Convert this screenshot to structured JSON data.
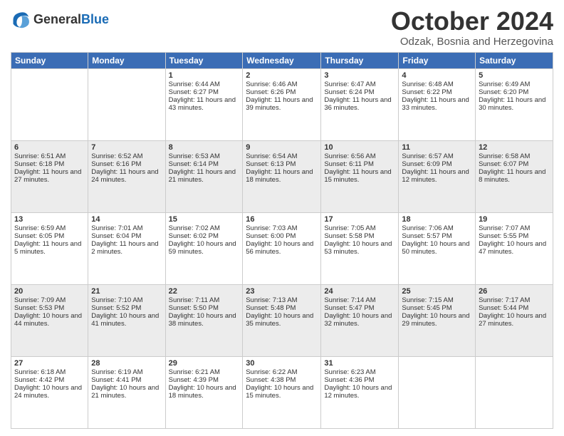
{
  "header": {
    "logo_line1": "General",
    "logo_line2": "Blue",
    "month": "October 2024",
    "location": "Odzak, Bosnia and Herzegovina"
  },
  "days_of_week": [
    "Sunday",
    "Monday",
    "Tuesday",
    "Wednesday",
    "Thursday",
    "Friday",
    "Saturday"
  ],
  "weeks": [
    {
      "bg": "white",
      "days": [
        {
          "num": "",
          "sunrise": "",
          "sunset": "",
          "daylight": ""
        },
        {
          "num": "",
          "sunrise": "",
          "sunset": "",
          "daylight": ""
        },
        {
          "num": "1",
          "sunrise": "Sunrise: 6:44 AM",
          "sunset": "Sunset: 6:27 PM",
          "daylight": "Daylight: 11 hours and 43 minutes."
        },
        {
          "num": "2",
          "sunrise": "Sunrise: 6:46 AM",
          "sunset": "Sunset: 6:26 PM",
          "daylight": "Daylight: 11 hours and 39 minutes."
        },
        {
          "num": "3",
          "sunrise": "Sunrise: 6:47 AM",
          "sunset": "Sunset: 6:24 PM",
          "daylight": "Daylight: 11 hours and 36 minutes."
        },
        {
          "num": "4",
          "sunrise": "Sunrise: 6:48 AM",
          "sunset": "Sunset: 6:22 PM",
          "daylight": "Daylight: 11 hours and 33 minutes."
        },
        {
          "num": "5",
          "sunrise": "Sunrise: 6:49 AM",
          "sunset": "Sunset: 6:20 PM",
          "daylight": "Daylight: 11 hours and 30 minutes."
        }
      ]
    },
    {
      "bg": "gray",
      "days": [
        {
          "num": "6",
          "sunrise": "Sunrise: 6:51 AM",
          "sunset": "Sunset: 6:18 PM",
          "daylight": "Daylight: 11 hours and 27 minutes."
        },
        {
          "num": "7",
          "sunrise": "Sunrise: 6:52 AM",
          "sunset": "Sunset: 6:16 PM",
          "daylight": "Daylight: 11 hours and 24 minutes."
        },
        {
          "num": "8",
          "sunrise": "Sunrise: 6:53 AM",
          "sunset": "Sunset: 6:14 PM",
          "daylight": "Daylight: 11 hours and 21 minutes."
        },
        {
          "num": "9",
          "sunrise": "Sunrise: 6:54 AM",
          "sunset": "Sunset: 6:13 PM",
          "daylight": "Daylight: 11 hours and 18 minutes."
        },
        {
          "num": "10",
          "sunrise": "Sunrise: 6:56 AM",
          "sunset": "Sunset: 6:11 PM",
          "daylight": "Daylight: 11 hours and 15 minutes."
        },
        {
          "num": "11",
          "sunrise": "Sunrise: 6:57 AM",
          "sunset": "Sunset: 6:09 PM",
          "daylight": "Daylight: 11 hours and 12 minutes."
        },
        {
          "num": "12",
          "sunrise": "Sunrise: 6:58 AM",
          "sunset": "Sunset: 6:07 PM",
          "daylight": "Daylight: 11 hours and 8 minutes."
        }
      ]
    },
    {
      "bg": "white",
      "days": [
        {
          "num": "13",
          "sunrise": "Sunrise: 6:59 AM",
          "sunset": "Sunset: 6:05 PM",
          "daylight": "Daylight: 11 hours and 5 minutes."
        },
        {
          "num": "14",
          "sunrise": "Sunrise: 7:01 AM",
          "sunset": "Sunset: 6:04 PM",
          "daylight": "Daylight: 11 hours and 2 minutes."
        },
        {
          "num": "15",
          "sunrise": "Sunrise: 7:02 AM",
          "sunset": "Sunset: 6:02 PM",
          "daylight": "Daylight: 10 hours and 59 minutes."
        },
        {
          "num": "16",
          "sunrise": "Sunrise: 7:03 AM",
          "sunset": "Sunset: 6:00 PM",
          "daylight": "Daylight: 10 hours and 56 minutes."
        },
        {
          "num": "17",
          "sunrise": "Sunrise: 7:05 AM",
          "sunset": "Sunset: 5:58 PM",
          "daylight": "Daylight: 10 hours and 53 minutes."
        },
        {
          "num": "18",
          "sunrise": "Sunrise: 7:06 AM",
          "sunset": "Sunset: 5:57 PM",
          "daylight": "Daylight: 10 hours and 50 minutes."
        },
        {
          "num": "19",
          "sunrise": "Sunrise: 7:07 AM",
          "sunset": "Sunset: 5:55 PM",
          "daylight": "Daylight: 10 hours and 47 minutes."
        }
      ]
    },
    {
      "bg": "gray",
      "days": [
        {
          "num": "20",
          "sunrise": "Sunrise: 7:09 AM",
          "sunset": "Sunset: 5:53 PM",
          "daylight": "Daylight: 10 hours and 44 minutes."
        },
        {
          "num": "21",
          "sunrise": "Sunrise: 7:10 AM",
          "sunset": "Sunset: 5:52 PM",
          "daylight": "Daylight: 10 hours and 41 minutes."
        },
        {
          "num": "22",
          "sunrise": "Sunrise: 7:11 AM",
          "sunset": "Sunset: 5:50 PM",
          "daylight": "Daylight: 10 hours and 38 minutes."
        },
        {
          "num": "23",
          "sunrise": "Sunrise: 7:13 AM",
          "sunset": "Sunset: 5:48 PM",
          "daylight": "Daylight: 10 hours and 35 minutes."
        },
        {
          "num": "24",
          "sunrise": "Sunrise: 7:14 AM",
          "sunset": "Sunset: 5:47 PM",
          "daylight": "Daylight: 10 hours and 32 minutes."
        },
        {
          "num": "25",
          "sunrise": "Sunrise: 7:15 AM",
          "sunset": "Sunset: 5:45 PM",
          "daylight": "Daylight: 10 hours and 29 minutes."
        },
        {
          "num": "26",
          "sunrise": "Sunrise: 7:17 AM",
          "sunset": "Sunset: 5:44 PM",
          "daylight": "Daylight: 10 hours and 27 minutes."
        }
      ]
    },
    {
      "bg": "white",
      "days": [
        {
          "num": "27",
          "sunrise": "Sunrise: 6:18 AM",
          "sunset": "Sunset: 4:42 PM",
          "daylight": "Daylight: 10 hours and 24 minutes."
        },
        {
          "num": "28",
          "sunrise": "Sunrise: 6:19 AM",
          "sunset": "Sunset: 4:41 PM",
          "daylight": "Daylight: 10 hours and 21 minutes."
        },
        {
          "num": "29",
          "sunrise": "Sunrise: 6:21 AM",
          "sunset": "Sunset: 4:39 PM",
          "daylight": "Daylight: 10 hours and 18 minutes."
        },
        {
          "num": "30",
          "sunrise": "Sunrise: 6:22 AM",
          "sunset": "Sunset: 4:38 PM",
          "daylight": "Daylight: 10 hours and 15 minutes."
        },
        {
          "num": "31",
          "sunrise": "Sunrise: 6:23 AM",
          "sunset": "Sunset: 4:36 PM",
          "daylight": "Daylight: 10 hours and 12 minutes."
        },
        {
          "num": "",
          "sunrise": "",
          "sunset": "",
          "daylight": ""
        },
        {
          "num": "",
          "sunrise": "",
          "sunset": "",
          "daylight": ""
        }
      ]
    }
  ]
}
